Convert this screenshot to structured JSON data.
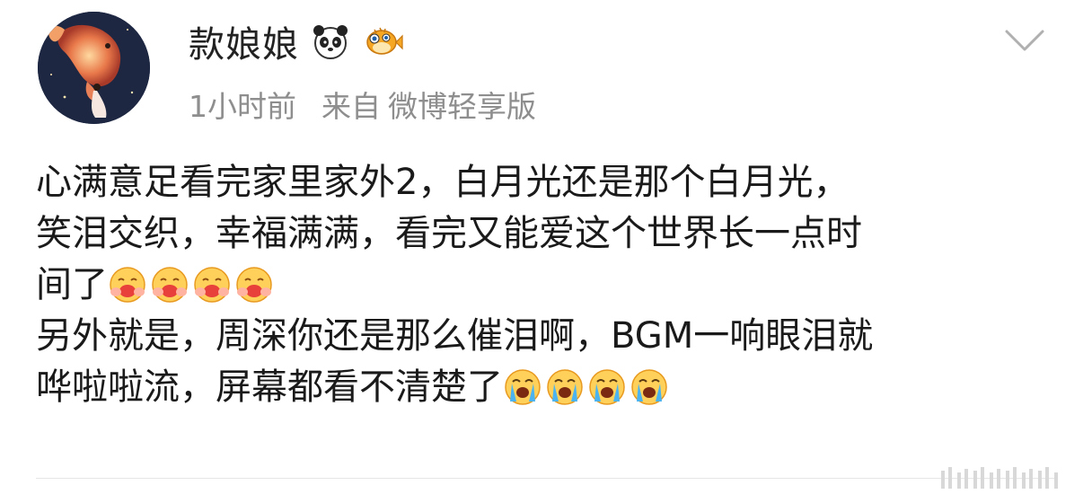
{
  "post": {
    "username": "款娘娘",
    "time": "1小时前",
    "from_label": "来自",
    "source": "微博轻享版",
    "badges": [
      "panda-icon",
      "pufferfish-icon"
    ],
    "menu_icon": "chevron-down-icon",
    "lines": [
      "心满意足看完家里家外2，白月光还是那个白月光，",
      "笑泪交织，幸福满满，看完又能爱这个世界长一点时",
      "间了",
      "另外就是，周深你还是那么催泪啊，BGM一响眼泪就",
      "哗啦啦流，屏幕都看不清楚了"
    ],
    "emoji_line3": [
      "hug-emoji",
      "hug-emoji",
      "hug-emoji",
      "hug-emoji"
    ],
    "emoji_line5": [
      "crying-emoji",
      "crying-emoji",
      "crying-emoji",
      "crying-emoji"
    ],
    "watermark_icon": "watermark-icon"
  }
}
